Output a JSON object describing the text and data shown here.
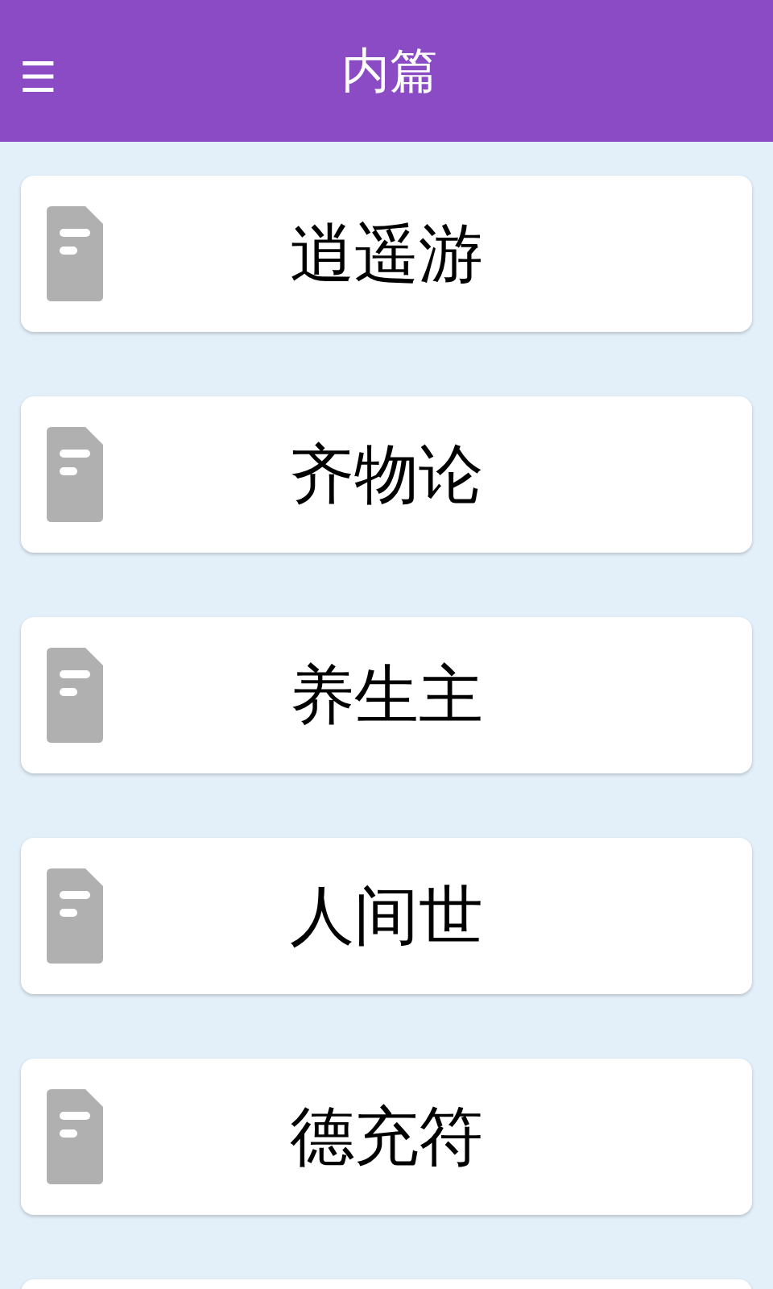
{
  "header": {
    "menu_icon": "☰",
    "title": "内篇"
  },
  "chapters": [
    {
      "title": "逍遥游"
    },
    {
      "title": "齐物论"
    },
    {
      "title": "养生主"
    },
    {
      "title": "人间世"
    },
    {
      "title": "德充符"
    }
  ]
}
